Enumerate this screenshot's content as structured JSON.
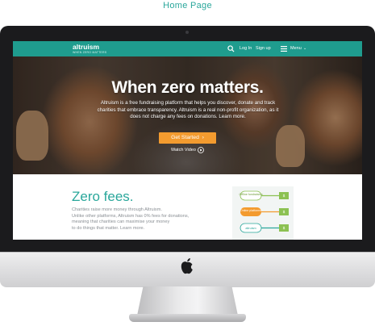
{
  "caption": "Home Page",
  "site": {
    "logo": "altruism",
    "logo_tagline": "WHEN ZERO MATTERS",
    "nav": {
      "login": "Log In",
      "signup": "Sign up",
      "menu": "Menu"
    },
    "hero": {
      "title": "When zero matters.",
      "subtitle": "Altruism is a free fundraising platform that helps you discover, donate and track charities that embrace transparency. Altruism is a real non-profit organization, as it does not charge any fees on donations. Learn more.",
      "cta_label": "Get Started",
      "watch_label": "Watch Video"
    },
    "fees": {
      "title": "Zero fees.",
      "body": [
        "Charities raise more money through Altruism.",
        "Unlike other platforms, Altruism has 0% fees for donations,",
        "meaning that charities can maximise your money",
        "to do things that matter.  Learn more."
      ]
    },
    "diagram": {
      "rows": [
        {
          "label": "Offline fundraising",
          "color": "#8cc152"
        },
        {
          "label": "Online platforms",
          "color": "#f39b2f"
        },
        {
          "label": "altruism",
          "color": "#2aa79b"
        }
      ]
    }
  },
  "colors": {
    "brand_teal": "#1f9c8e",
    "accent_orange": "#f39b2f",
    "caption_teal": "#2aa79b"
  },
  "icons": [
    "search-icon",
    "menu-icon",
    "chevron-down-icon",
    "play-icon",
    "apple-logo-icon"
  ]
}
